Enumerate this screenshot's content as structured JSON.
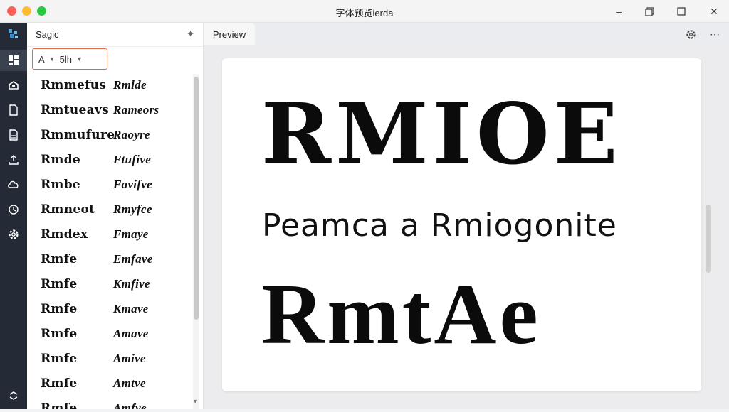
{
  "window": {
    "title": "字体预览ierda"
  },
  "sidebar": {
    "title": "Sagic",
    "filter_icon_label": "A",
    "filter_value": "5lh"
  },
  "font_rows": [
    [
      "Rmmefus",
      "Rmlde"
    ],
    [
      "Rmtueavs",
      "Rameors"
    ],
    [
      "Rmmufure",
      "Raoyre"
    ],
    [
      "Rmde",
      "Ftufive"
    ],
    [
      "Rmbe",
      "Favifve"
    ],
    [
      "Rmneot",
      "Rmyfce"
    ],
    [
      "Rmdex",
      "Fmaye"
    ],
    [
      "Rmfe",
      "Emfave"
    ],
    [
      "Rmfe",
      "Kmfive"
    ],
    [
      "Rmfe",
      "Kmave"
    ],
    [
      "Rmfe",
      "Amave"
    ],
    [
      "Rmfe",
      "Amive"
    ],
    [
      "Rmfe",
      "Amtve"
    ],
    [
      "Rmfe",
      "Amfve"
    ]
  ],
  "preview": {
    "tab_label": "Preview",
    "line1": "RMIOE",
    "line2": "Peamca a Rmiogonite",
    "line3": "RmtAe"
  }
}
